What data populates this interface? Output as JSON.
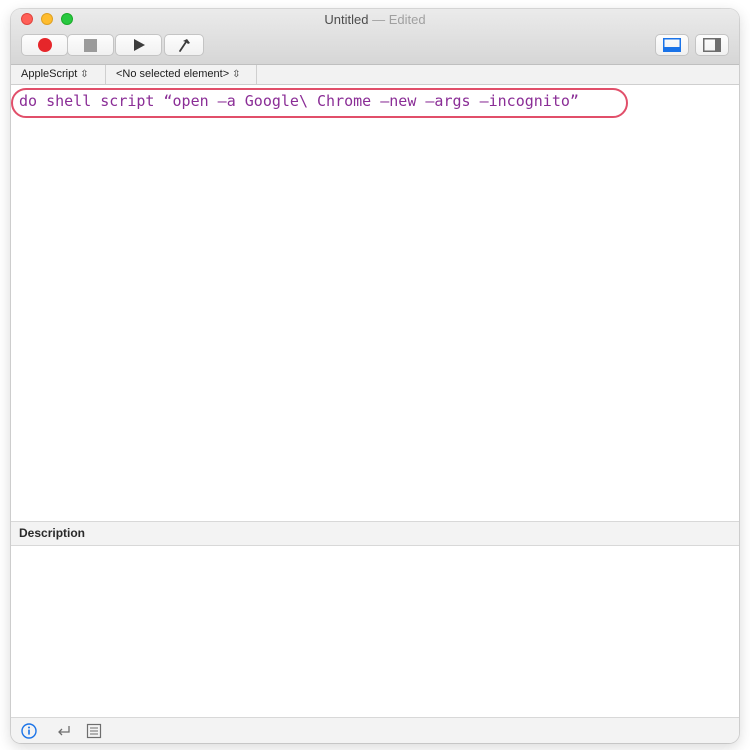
{
  "window": {
    "title": "Untitled",
    "title_separator": " — ",
    "title_status": "Edited"
  },
  "toolbar": {
    "buttons": [
      {
        "name": "record",
        "icon": "record-icon",
        "color": "#e6262a"
      },
      {
        "name": "stop",
        "icon": "stop-icon"
      },
      {
        "name": "run",
        "icon": "play-icon"
      },
      {
        "name": "compile",
        "icon": "hammer-icon"
      }
    ],
    "view_buttons": [
      {
        "name": "show-bottom-pane",
        "icon": "bottom-pane-icon",
        "selected": true,
        "accent": "#1a73e8"
      },
      {
        "name": "show-side-pane",
        "icon": "side-pane-icon",
        "selected": false
      }
    ]
  },
  "navbar": {
    "language": "AppleScript",
    "element": "<No selected element>"
  },
  "editor": {
    "code": "do shell script “open –a Google\\ Chrome –new –args –incognito”",
    "code_color": "#8a2d96",
    "highlight_color": "#e14f6a"
  },
  "description": {
    "header": "Description",
    "body": ""
  },
  "bottombar": {
    "icons": [
      {
        "name": "info",
        "icon": "info-icon",
        "accent": "#1a73e8"
      },
      {
        "name": "return",
        "icon": "return-arrow-icon"
      },
      {
        "name": "log",
        "icon": "log-list-icon"
      }
    ]
  }
}
